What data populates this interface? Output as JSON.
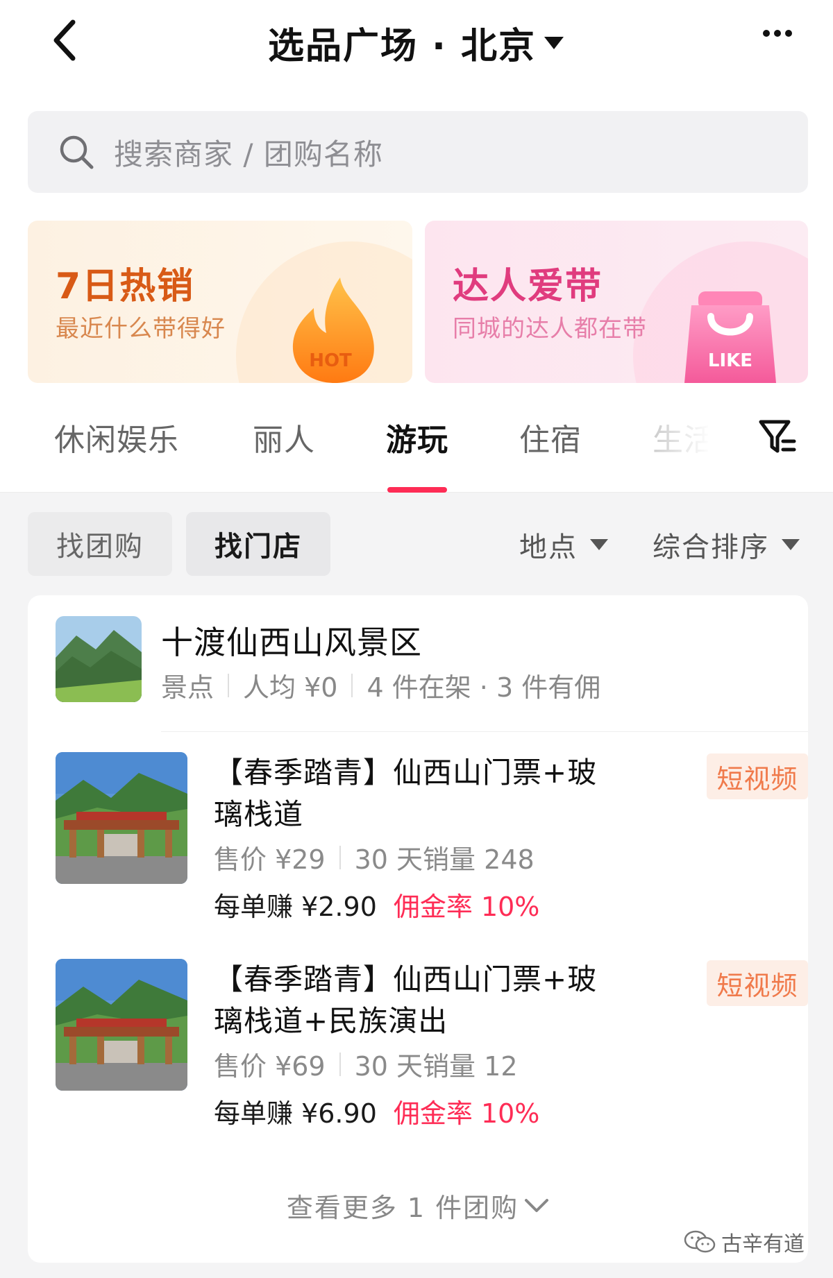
{
  "header": {
    "title": "选品广场 · 北京"
  },
  "search": {
    "placeholder": "搜索商家 / 团购名称"
  },
  "promos": [
    {
      "title": "7日热销",
      "subtitle": "最近什么带得好",
      "art_text": "HOT"
    },
    {
      "title": "达人爱带",
      "subtitle": "同城的达人都在带",
      "art_text": "LIKE"
    }
  ],
  "category_tabs": [
    {
      "label": "休闲娱乐",
      "active": false
    },
    {
      "label": "丽人",
      "active": false
    },
    {
      "label": "游玩",
      "active": true
    },
    {
      "label": "住宿",
      "active": false
    },
    {
      "label": "生活",
      "active": false
    }
  ],
  "filters": {
    "segment_group": "找团购",
    "segment_store": "找门店",
    "location": "地点",
    "sort": "综合排序"
  },
  "store": {
    "name": "十渡仙西山风景区",
    "type": "景点",
    "avg_price": "人均 ¥0",
    "listing": "4 件在架 · 3 件有佣"
  },
  "deals": [
    {
      "title": "【春季踏青】仙西山门票+玻璃栈道",
      "badge": "短视频",
      "price": "售价 ¥29",
      "sales": "30 天销量 248",
      "earn": "每单赚 ¥2.90",
      "rate": "佣金率 10%"
    },
    {
      "title": "【春季踏青】仙西山门票+玻璃栈道+民族演出",
      "badge": "短视频",
      "price": "售价 ¥69",
      "sales": "30 天销量 12",
      "earn": "每单赚 ¥6.90",
      "rate": "佣金率 10%"
    }
  ],
  "see_more": "查看更多 1 件团购",
  "watermark": "古辛有道",
  "colors": {
    "accent": "#fe2c55",
    "hot": "#d85a16",
    "like": "#e03c7e",
    "badge_text": "#f07a4b",
    "badge_bg": "#fdeee6"
  }
}
